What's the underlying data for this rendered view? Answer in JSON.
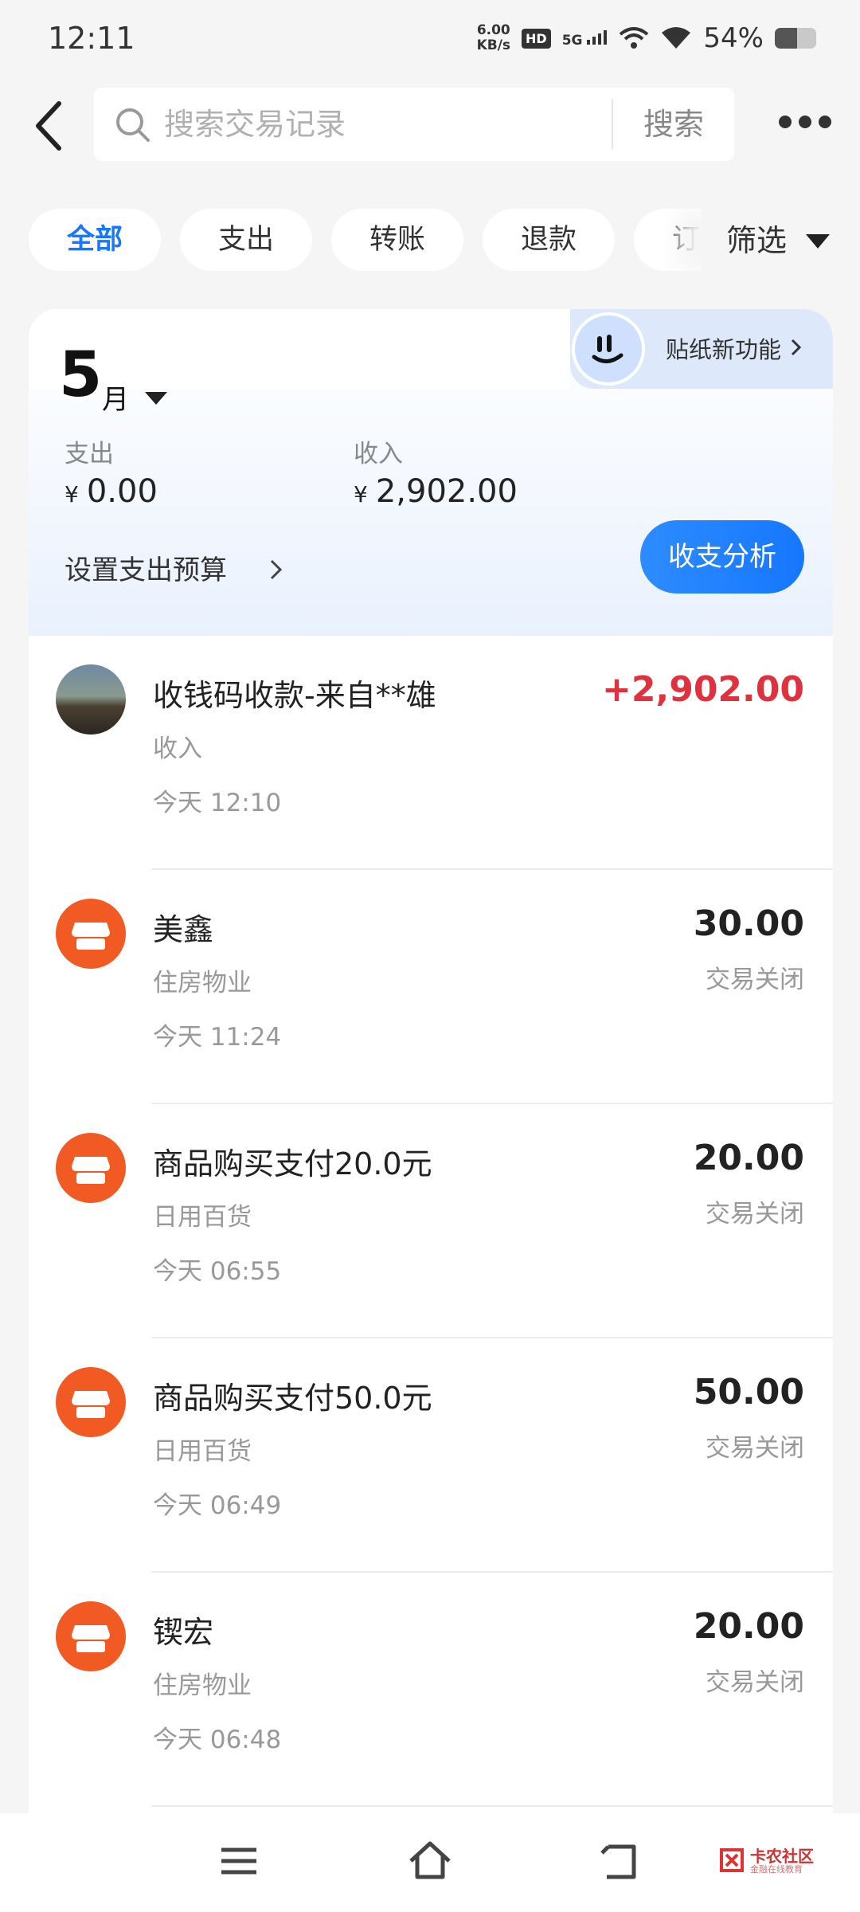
{
  "status_bar": {
    "time": "12:11",
    "speed_value": "6.00",
    "speed_unit": "KB/s",
    "hd": "HD",
    "network": "5G",
    "battery_text": "54%",
    "battery_level": 0.54
  },
  "header": {
    "search_placeholder": "搜索交易记录",
    "search_button": "搜索"
  },
  "tabs": [
    {
      "label": "全部",
      "active": true
    },
    {
      "label": "支出",
      "active": false
    },
    {
      "label": "转账",
      "active": false
    },
    {
      "label": "退款",
      "active": false
    },
    {
      "label": "订单",
      "active": false
    }
  ],
  "filter_label": "筛选",
  "summary": {
    "sticker_label": "贴纸新功能",
    "month": "5",
    "month_unit": "月",
    "expense_label": "支出",
    "expense_currency": "¥",
    "expense_amount": "0.00",
    "income_label": "收入",
    "income_currency": "¥",
    "income_amount": "2,902.00",
    "budget_label": "设置支出预算",
    "analysis_button": "收支分析"
  },
  "transactions": [
    {
      "title": "收钱码收款-来自**雄",
      "category": "收入",
      "time": "今天 12:10",
      "amount": "+2,902.00",
      "status": "",
      "type": "income",
      "avatar": "photo"
    },
    {
      "title": "美鑫",
      "category": "住房物业",
      "time": "今天 11:24",
      "amount": "30.00",
      "status": "交易关闭",
      "type": "expense",
      "avatar": "shop-icon"
    },
    {
      "title": "商品购买支付20.0元",
      "category": "日用百货",
      "time": "今天 06:55",
      "amount": "20.00",
      "status": "交易关闭",
      "type": "expense",
      "avatar": "shop-icon"
    },
    {
      "title": "商品购买支付50.0元",
      "category": "日用百货",
      "time": "今天 06:49",
      "amount": "50.00",
      "status": "交易关闭",
      "type": "expense",
      "avatar": "shop-icon"
    },
    {
      "title": "锲宏",
      "category": "住房物业",
      "time": "今天 06:48",
      "amount": "20.00",
      "status": "交易关闭",
      "type": "expense",
      "avatar": "shop-icon"
    }
  ],
  "watermark": {
    "text": "卡农社区",
    "subtext": "金融在线教育"
  },
  "colors": {
    "accent": "#1677ff",
    "income": "#e0313e",
    "shop": "#f15a22"
  }
}
